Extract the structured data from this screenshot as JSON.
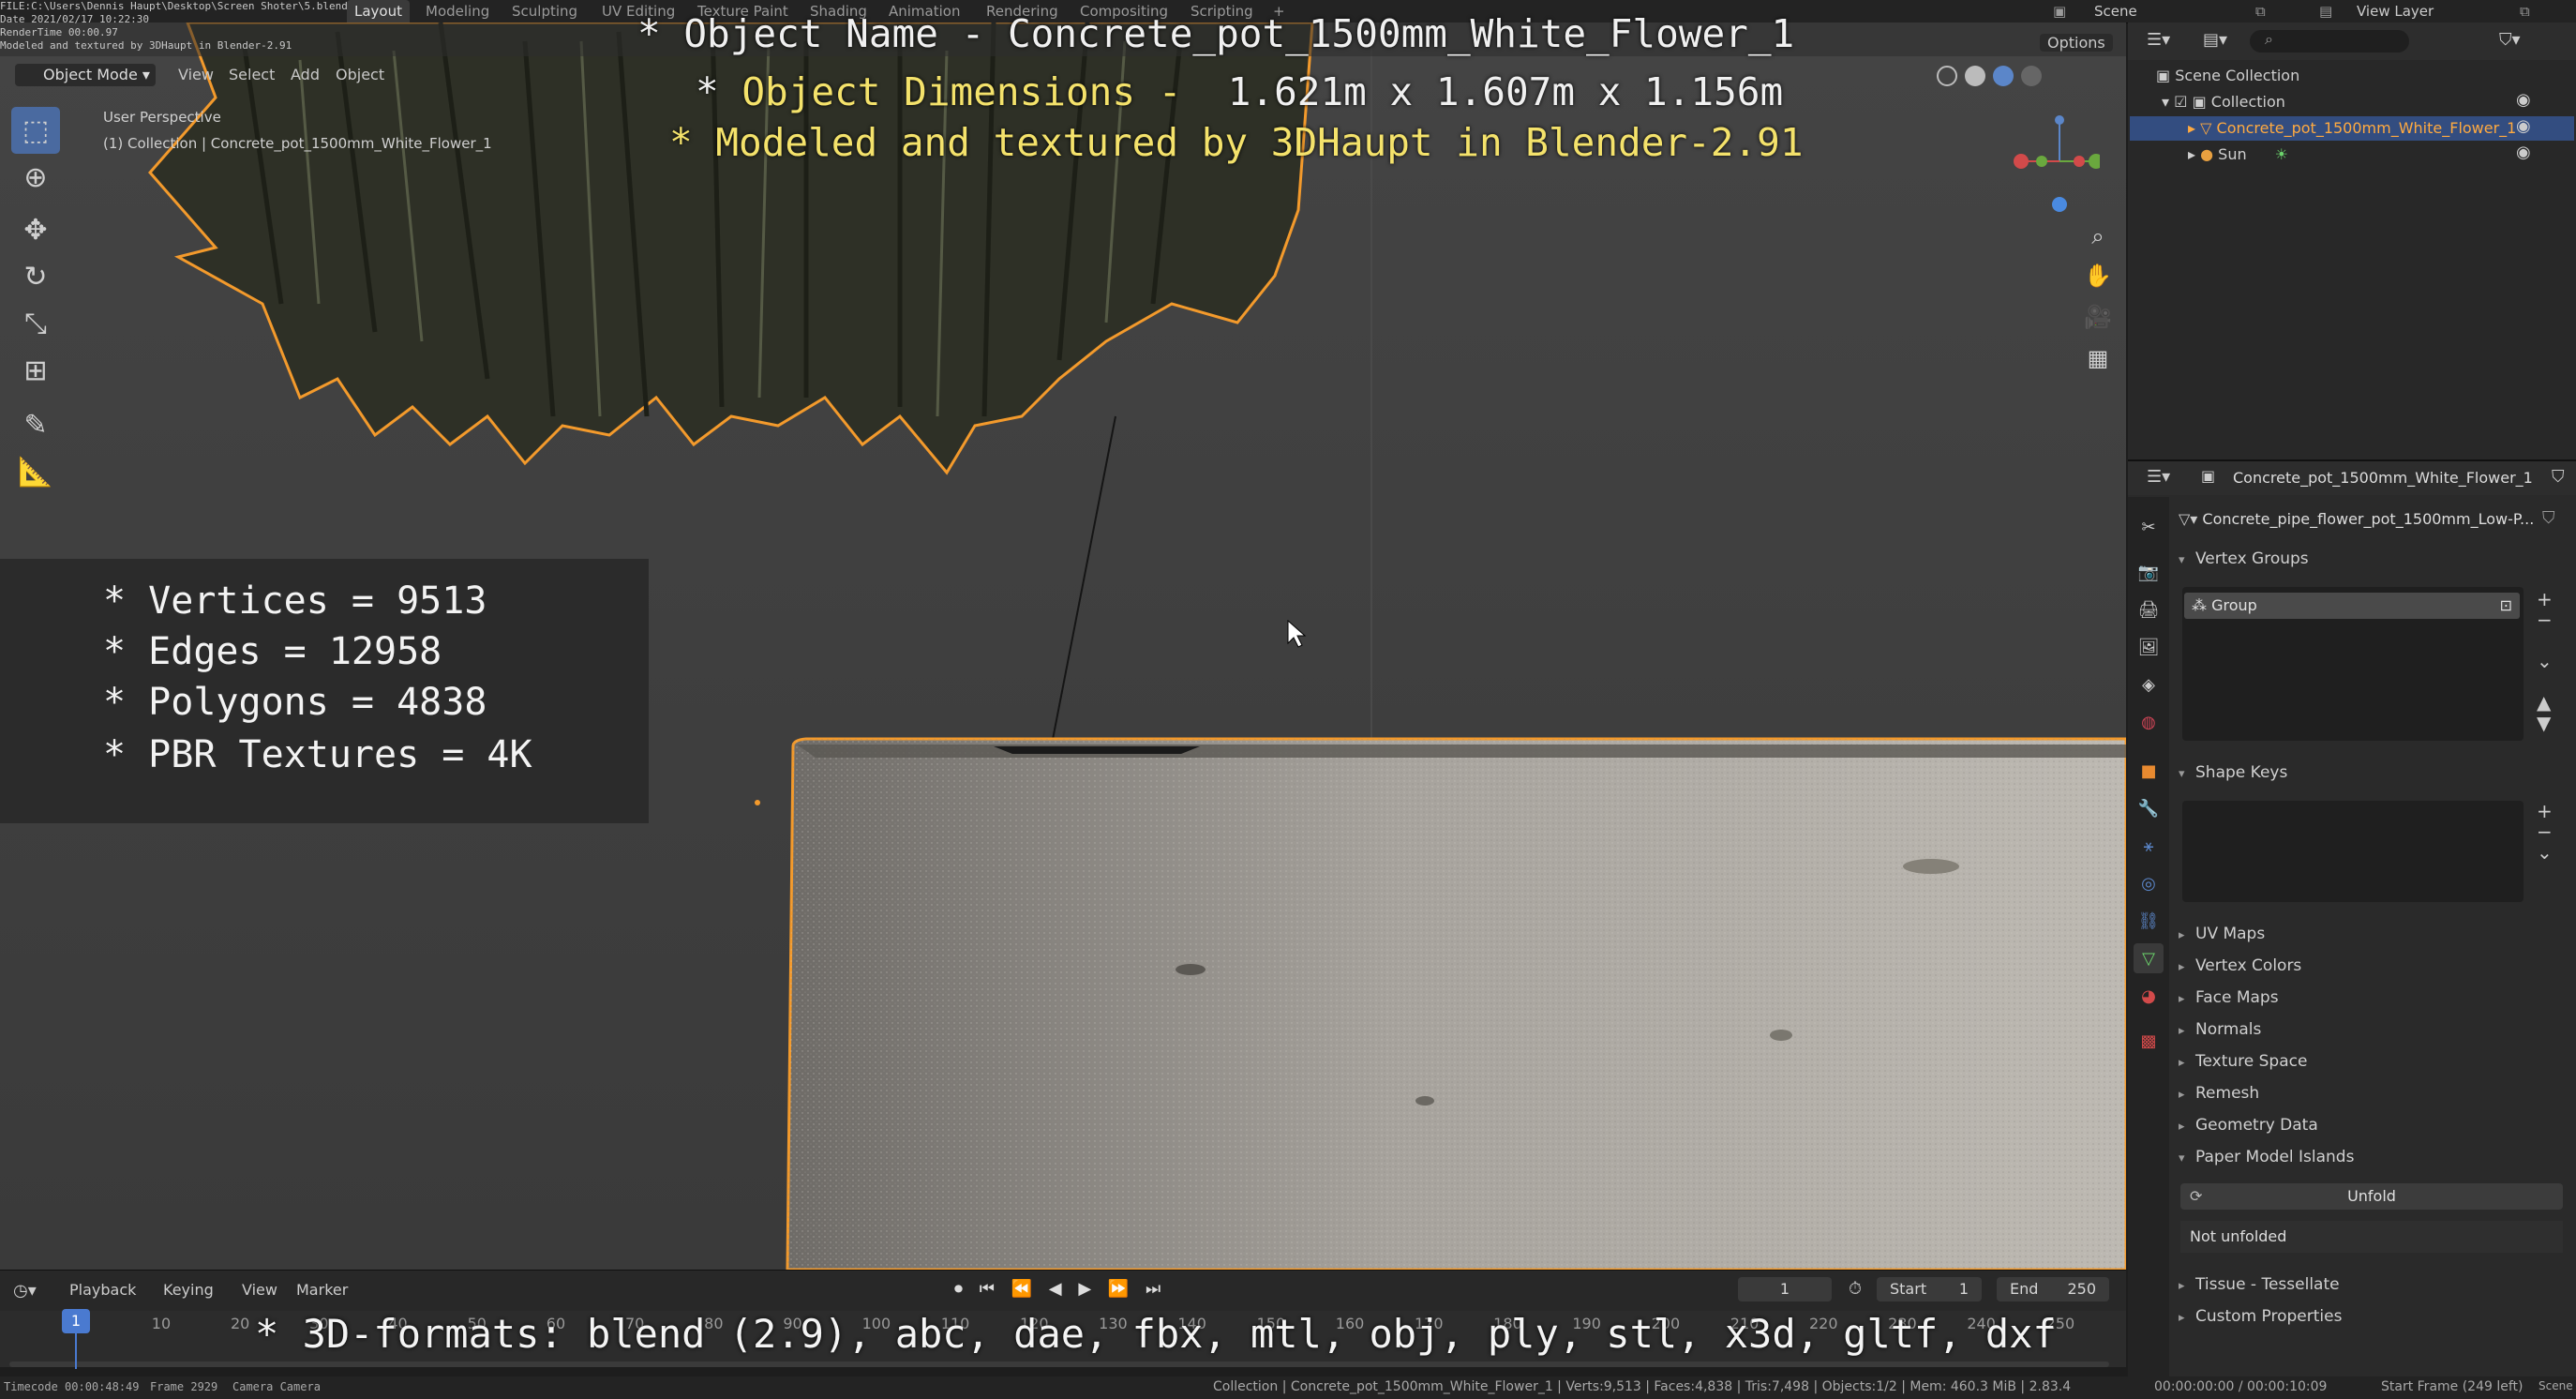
{
  "file_info": {
    "line1": "FILE:C:\\Users\\Dennis Haupt\\Desktop\\Screen Shoter\\5.blend",
    "line2": "Date 2021/02/17 10:22:30",
    "line3": "RenderTime 00:00.97",
    "line4": "Modeled and textured by 3DHaupt in Blender-2.91"
  },
  "workspace_tabs": [
    "Layout",
    "Modeling",
    "Sculpting",
    "UV Editing",
    "Texture Paint",
    "Shading",
    "Animation",
    "Rendering",
    "Compositing",
    "Scripting",
    "+"
  ],
  "scene": "Scene",
  "view_layer": "View Layer",
  "viewport": {
    "mode": "Object Mode",
    "menus": [
      "View",
      "Select",
      "Add",
      "Object"
    ],
    "options": "Options",
    "perspective": "User Perspective",
    "collection_line": "(1) Collection | Concrete_pot_1500mm_White_Flower_1"
  },
  "overlay": {
    "name_line": "* Object Name - Concrete_pot_1500mm_White_Flower_1",
    "dims_prefix": "* ",
    "dims_label": "Object Dimensions - ",
    "dims_value": " 1.621m x 1.607m x 1.156m",
    "author_line": "* Modeled and textured by 3DHaupt in Blender-2.91",
    "stats": [
      "* Vertices = 9513",
      "* Edges = 12958",
      "* Polygons = 4838",
      "* PBR Textures = 4K"
    ],
    "formats": "* 3D-formats: blend (2.9), abc, dae, fbx, mtl, obj, ply, stl, x3d, gltf, dxf"
  },
  "outliner": {
    "scene_collection": "Scene Collection",
    "collection": "Collection",
    "object": "Concrete_pot_1500mm_White_Flower_1",
    "sun": "Sun"
  },
  "properties": {
    "object_name": "Concrete_pot_1500mm_White_Flower_1",
    "mesh_name": "Concrete_pipe_flower_pot_1500mm_Low-P...",
    "vertex_groups": "Vertex Groups",
    "group_item": "Group",
    "shape_keys": "Shape Keys",
    "collapsed_panels": [
      "UV Maps",
      "Vertex Colors",
      "Face Maps",
      "Normals",
      "Texture Space",
      "Remesh",
      "Geometry Data"
    ],
    "paper_model": "Paper Model Islands",
    "unfold_button": "Unfold",
    "not_unfolded": "Not unfolded",
    "tissue": "Tissue - Tessellate",
    "custom_props": "Custom Properties"
  },
  "timeline": {
    "menus": [
      "Playback",
      "Keying",
      "View",
      "Marker"
    ],
    "current_frame": "1",
    "start_label": "Start",
    "start": "1",
    "end_label": "End",
    "end": "250",
    "ticks": [
      "1",
      "10",
      "20",
      "30",
      "40",
      "50",
      "60",
      "70",
      "80",
      "90",
      "100",
      "110",
      "120",
      "130",
      "140",
      "150",
      "160",
      "170",
      "180",
      "190",
      "200",
      "210",
      "220",
      "230",
      "240",
      "250"
    ]
  },
  "status": {
    "timecode": "Timecode 00:00:48:49",
    "frame": "Frame 2929",
    "camera": "Camera Camera",
    "stats": "Collection | Concrete_pot_1500mm_White_Flower_1 | Verts:9,513 | Faces:4,838 | Tris:7,498 | Objects:1/2 | Mem: 460.3 MiB | 2.83.4",
    "timecode_right": "00:00:00:00 / 00:00:10:09",
    "start_frame": "Start Frame (249 left)",
    "scene_label": "Scene"
  }
}
